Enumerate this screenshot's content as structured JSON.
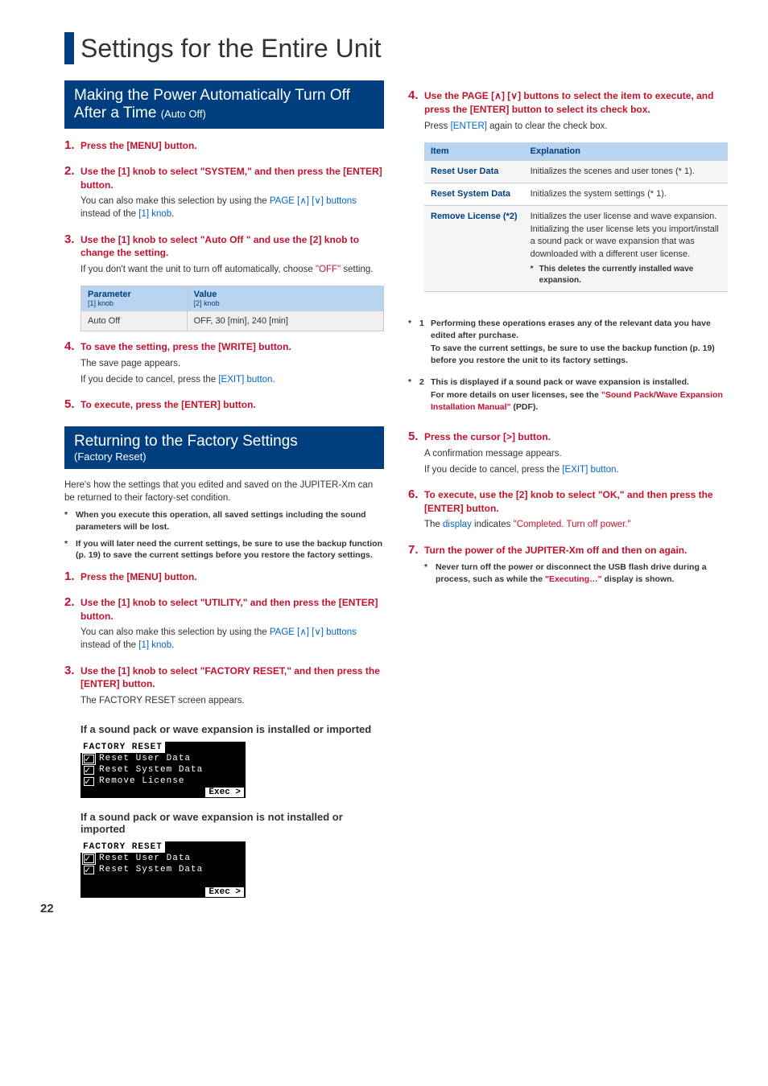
{
  "page_title": "Settings for the Entire Unit",
  "page_number": "22",
  "section1": {
    "heading_main": "Making the Power Automatically Turn Off After a Time ",
    "heading_sub": "(Auto Off)",
    "steps": [
      {
        "num": "1.",
        "title_a": "Press the ",
        "title_b": "[MENU] button",
        "title_c": "."
      },
      {
        "num": "2.",
        "title_a": "Use the ",
        "title_b": "[1] knob",
        "title_c": " to select ",
        "title_d": "\"SYSTEM,\"",
        "title_e": " and then press the ",
        "title_f": "[ENTER] button",
        "title_g": ".",
        "desc_a": "You can also make this selection by using the ",
        "desc_b": "PAGE [",
        "desc_b2": "] [",
        "desc_b3": "] buttons",
        "desc_c": " instead of the ",
        "desc_d": "[1] knob",
        "desc_e": "."
      },
      {
        "num": "3.",
        "title_a": "Use the ",
        "title_b": "[1] knob",
        "title_c": " to select ",
        "title_d": "\"Auto Off \"",
        "title_e": " and use the ",
        "title_f": "[2] knob",
        "title_g": " to change the setting.",
        "desc_a": "If you don't want the unit to turn off automatically, choose ",
        "desc_b": "\"OFF\"",
        "desc_c": " setting."
      },
      {
        "num": "4.",
        "title_a": "To save the setting, press the ",
        "title_b": "[WRITE] button",
        "title_c": ".",
        "desc_a": "The save page appears.",
        "desc2_a": "If you decide to cancel, press the ",
        "desc2_b": "[EXIT] button",
        "desc2_c": "."
      },
      {
        "num": "5.",
        "title_a": "To execute, press the ",
        "title_b": "[ENTER] button",
        "title_c": "."
      }
    ],
    "table": {
      "h1": "Parameter",
      "h1s": "[1] knob",
      "h2": "Value",
      "h2s": "[2] knob",
      "r1c1": "Auto Off",
      "r1c2": "OFF, 30 [min], 240 [min]"
    }
  },
  "section2": {
    "heading_main": "Returning to the Factory Settings",
    "heading_sub": "(Factory Reset)",
    "intro": "Here's how the settings that you edited and saved on the JUPITER-Xm can be returned to their factory-set condition.",
    "note1": "When you execute this operation, all saved settings including the sound parameters will be lost.",
    "note2": "If you will later need the current settings, be sure to use the backup function (p. 19) to save the current settings before you restore the factory settings.",
    "steps": {
      "s1": {
        "num": "1.",
        "a": "Press the ",
        "b": "[MENU] button",
        "c": "."
      },
      "s2": {
        "num": "2.",
        "a": "Use the ",
        "b": "[1] knob",
        "c": " to select ",
        "d": "\"UTILITY,\"",
        "e": " and then press the ",
        "f": "[ENTER] button",
        "g": ".",
        "da": "You can also make this selection by using the ",
        "db": "PAGE [",
        "db2": "] [",
        "db3": "] buttons",
        "dc": " instead of the ",
        "dd": "[1] knob",
        "de": "."
      },
      "s3": {
        "num": "3.",
        "a": "Use the ",
        "b": "[1] knob",
        "c": " to select ",
        "d": "\"FACTORY RESET,\"",
        "e": " and then press the ",
        "f": "[ENTER] button",
        "g": ".",
        "da": "The FACTORY RESET screen appears."
      }
    },
    "sub1": "If a sound pack or wave expansion is installed or imported",
    "sub2": "If a sound pack or wave expansion is not installed or imported",
    "scr": {
      "title": "FACTORY RESET",
      "r1": "Reset User Data",
      "r2": "Reset System Data",
      "r3": "Remove License",
      "exec": "Exec >"
    }
  },
  "right": {
    "s4": {
      "num": "4.",
      "a": "Use the ",
      "b": "PAGE [",
      "b2": "] [",
      "b3": "] buttons",
      "c": " to select the item to execute, and press the ",
      "f": "[ENTER] button",
      "g": " to select its check box.",
      "da": "Press ",
      "db": "[ENTER]",
      "dc": " again to clear the check box."
    },
    "table": {
      "h1": "Item",
      "h2": "Explanation",
      "r1n": "Reset User Data",
      "r1d": "Initializes the scenes and user tones (* 1).",
      "r2n": "Reset System Data",
      "r2d": "Initializes the system settings (* 1).",
      "r3n": "Remove License (*2)",
      "r3d": "Initializes the user license and wave expansion. Initializing the user license lets you import/install a sound pack or wave expansion that was downloaded with a different user license.",
      "r3star": "This deletes the currently installed wave expansion."
    },
    "nn1a": "Performing these operations erases any of the relevant data you have edited after purchase.",
    "nn1b": "To save the current settings, be sure to use the backup function (p. 19) before you restore the unit to its factory settings.",
    "nn2a": "This is displayed if a sound pack or wave expansion is installed.",
    "nn2b_a": "For more details on user licenses, see the ",
    "nn2b_b": "\"Sound Pack/Wave Expansion Installation Manual\"",
    "nn2b_c": " (PDF).",
    "s5": {
      "num": "5.",
      "a": "Press the ",
      "b": "cursor [>] button",
      "c": ".",
      "da": "A confirmation message appears.",
      "d2a": "If you decide to cancel, press the ",
      "d2b": "[EXIT] button",
      "d2c": "."
    },
    "s6": {
      "num": "6.",
      "a": "To execute, use the ",
      "b": "[2] knob",
      "c": " to select ",
      "d": "\"OK,\"",
      "e": " and then press the ",
      "f": "[ENTER] button",
      "g": ".",
      "da": "The ",
      "db": "display",
      "dc": " indicates ",
      "dd": "\"Completed. Turn off power.\""
    },
    "s7": {
      "num": "7.",
      "a": "Turn the power of the JUPITER-Xm off and then on again.",
      "na": "Never turn off the power or disconnect the USB flash drive during a process, such as while the ",
      "nb": "\"Executing…\"",
      "nc": " display is shown."
    }
  }
}
